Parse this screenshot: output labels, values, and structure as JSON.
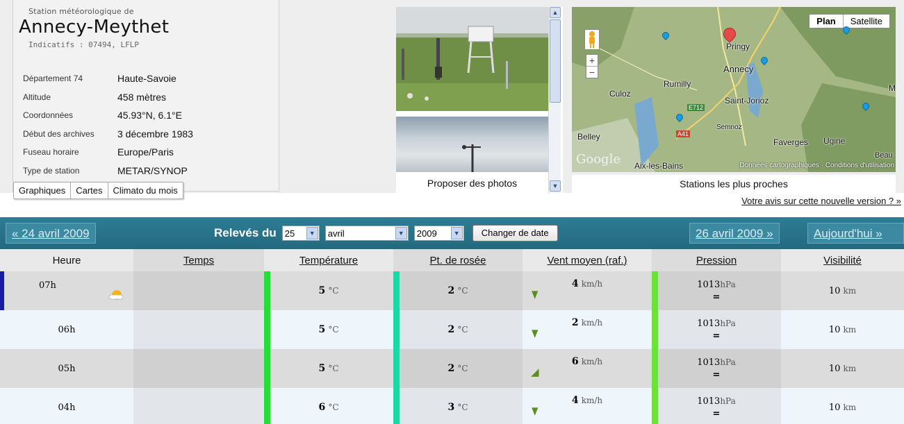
{
  "station": {
    "prefix": "Station météorologique de",
    "name": "Annecy-Meythet",
    "indicatifs": "Indicatifs : 07494, LFLP",
    "details": [
      {
        "label": "Département 74",
        "value": "Haute-Savoie"
      },
      {
        "label": "Altitude",
        "value": "458 mètres"
      },
      {
        "label": "Coordonnées",
        "value": "45.93°N, 6.1°E"
      },
      {
        "label": "Début des archives",
        "value": "3 décembre 1983"
      },
      {
        "label": "Fuseau horaire",
        "value": "Europe/Paris"
      },
      {
        "label": "Type de station",
        "value": "METAR/SYNOP"
      }
    ]
  },
  "tabs": [
    "Graphiques",
    "Cartes",
    "Climato du mois"
  ],
  "photos": {
    "caption": "Proposer des photos"
  },
  "map": {
    "caption": "Stations les plus proches",
    "btn_plan": "Plan",
    "btn_satellite": "Satellite",
    "zoom_in": "+",
    "zoom_out": "−",
    "logo": "Google",
    "credits": "Données cartographiques · Conditions d'utilisation",
    "places": [
      "Annecy",
      "Rumilly",
      "Culoz",
      "Saint-Jorioz",
      "Semnoz",
      "Belley",
      "Faverges",
      "Ugine",
      "Aix-les-Bains",
      "Pringy",
      "E712",
      "A41",
      "M",
      "Beau"
    ]
  },
  "feedback_link": "Votre avis sur cette nouvelle version ? »",
  "datebar": {
    "prev": "« 24 avril 2009",
    "label": "Relevés du",
    "day": "25",
    "month": "avril",
    "year": "2009",
    "change_btn": "Changer de date",
    "next": "26 avril 2009 »",
    "today": "Aujourd'hui »"
  },
  "colors": {
    "temp_bar": "#22e03a",
    "dew_bar": "#1ed6a8",
    "press_bar": "#6fe03a",
    "datebar": "#2e7d94"
  },
  "table": {
    "headers": [
      "Heure",
      "Temps",
      "Température",
      "Pt. de rosée",
      "Vent moyen (raf.)",
      "Pression",
      "Visibilité"
    ],
    "temp_unit": "°C",
    "wind_unit": "km/h",
    "press_unit": "hPa",
    "vis_unit": "km",
    "rows": [
      {
        "hour": "07h",
        "weather_icon": "sun-cloud-icon",
        "temp": "5",
        "dew": "2",
        "wind": "4",
        "wind_dir": "south",
        "pressure": "1013",
        "trend": "=",
        "visibility": "10"
      },
      {
        "hour": "06h",
        "weather_icon": "",
        "temp": "5",
        "dew": "2",
        "wind": "2",
        "wind_dir": "south",
        "pressure": "1013",
        "trend": "=",
        "visibility": "10"
      },
      {
        "hour": "05h",
        "weather_icon": "",
        "temp": "5",
        "dew": "2",
        "wind": "6",
        "wind_dir": "south-west",
        "pressure": "1013",
        "trend": "=",
        "visibility": "10"
      },
      {
        "hour": "04h",
        "weather_icon": "",
        "temp": "6",
        "dew": "3",
        "wind": "4",
        "wind_dir": "south",
        "pressure": "1013",
        "trend": "=",
        "visibility": "10"
      }
    ]
  }
}
